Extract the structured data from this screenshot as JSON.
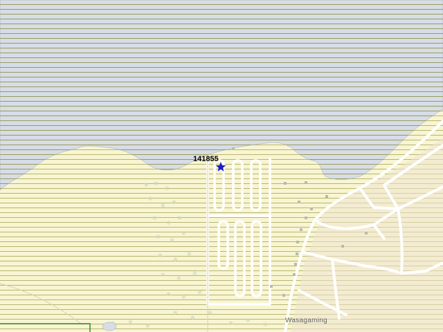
{
  "map": {
    "marker": {
      "label": "141855",
      "icon": "star-icon",
      "color": "#1a1acc"
    },
    "place_label": "Wasagaming",
    "colors": {
      "water": "#d7dde6",
      "land": "#f8f5d2",
      "hatch_water": "#9a9a58",
      "hatch_land": "#b8b470",
      "road": "#ffffff",
      "built_area": "#efe3cf",
      "vegetation_symbol": "#c9d8c0"
    }
  }
}
